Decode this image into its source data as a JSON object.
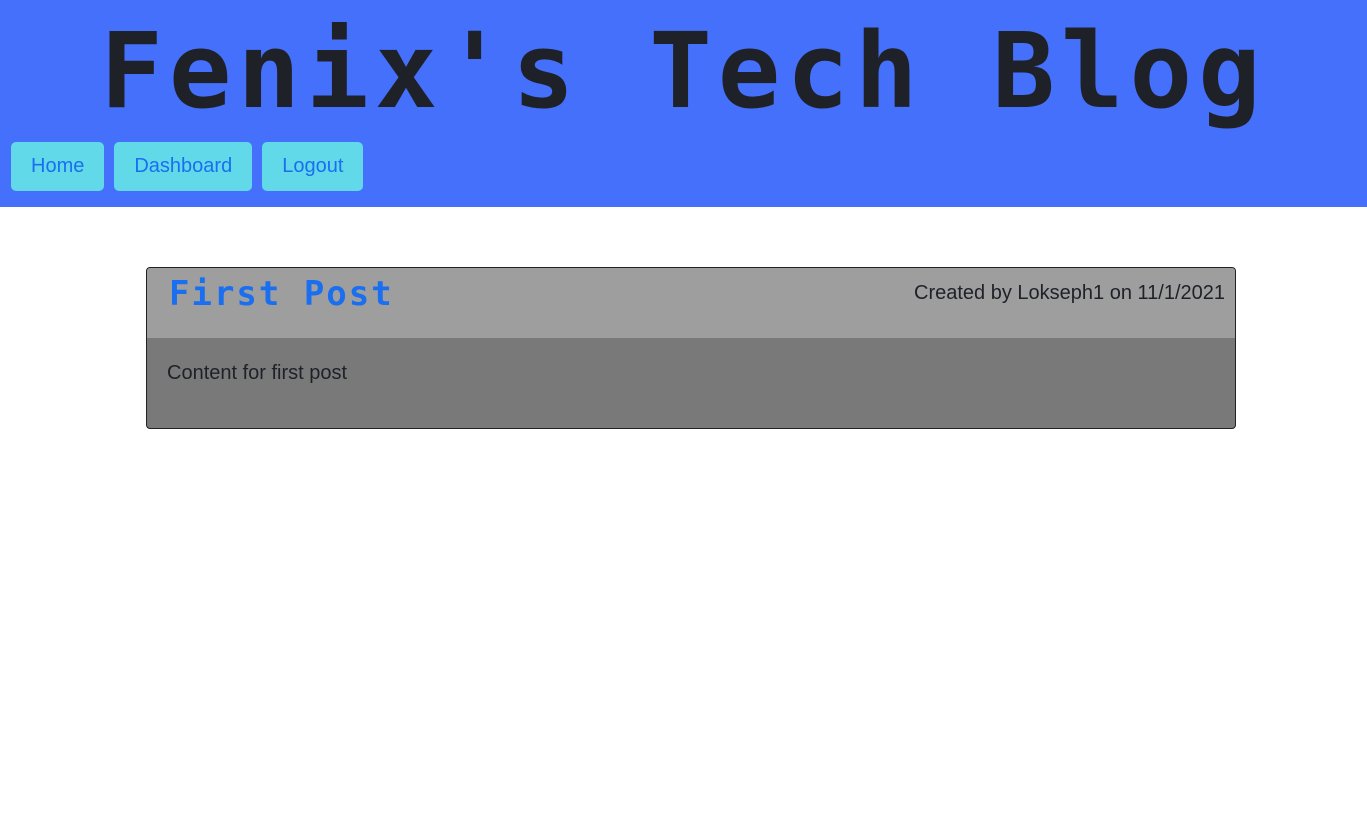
{
  "header": {
    "site_title": "Fenix's Tech Blog",
    "background_color": "#4570fb"
  },
  "nav": {
    "items": [
      {
        "label": "Home"
      },
      {
        "label": "Dashboard"
      },
      {
        "label": "Logout"
      }
    ],
    "button_color": "#61d9e8",
    "text_color": "#1a6ff0"
  },
  "posts": [
    {
      "title": "First Post",
      "meta": "Created by Lokseph1 on 11/1/2021",
      "content": "Content for first post"
    }
  ]
}
